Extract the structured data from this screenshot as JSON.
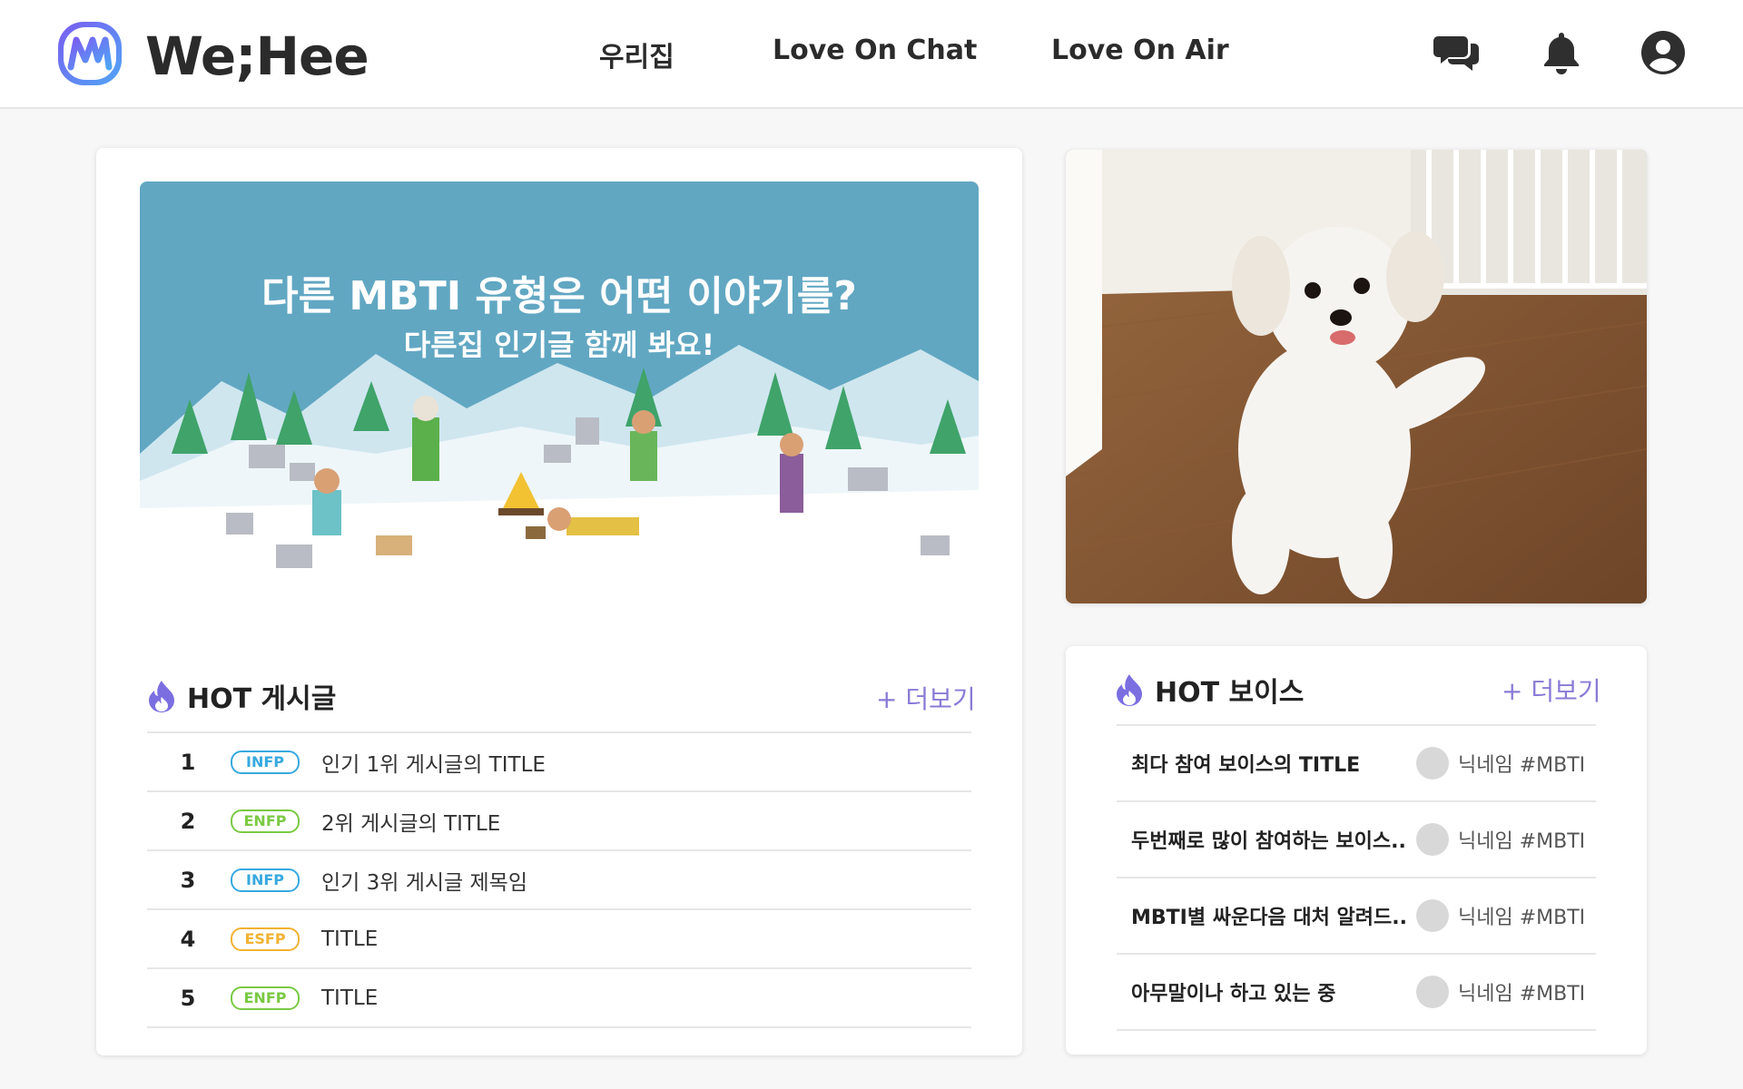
{
  "app": {
    "name": "We;Hee",
    "accent": "#8a7ad6",
    "logo_color": "#6a6cf0"
  },
  "nav": {
    "items": [
      {
        "label": "우리집"
      },
      {
        "label": "Love On Chat"
      },
      {
        "label": "Love On Air"
      }
    ],
    "icons": [
      "chat-bubbles-icon",
      "bell-icon",
      "user-account-icon"
    ]
  },
  "banner": {
    "title": "다른 MBTI 유형은 어떤 이야기를?",
    "subtitle": "다른집 인기글 함께 봐요!"
  },
  "hot_posts": {
    "title": "HOT 게시글",
    "more_label": "+ 더보기",
    "items": [
      {
        "rank": "1",
        "mbti": "INFP",
        "mbti_color": "#37a9e0",
        "title": "인기 1위 게시글의 TITLE"
      },
      {
        "rank": "2",
        "mbti": "ENFP",
        "mbti_color": "#7ac943",
        "title": "2위 게시글의 TITLE"
      },
      {
        "rank": "3",
        "mbti": "INFP",
        "mbti_color": "#37a9e0",
        "title": "인기 3위 게시글 제목임"
      },
      {
        "rank": "4",
        "mbti": "ESFP",
        "mbti_color": "#f2b233",
        "title": "TITLE"
      },
      {
        "rank": "5",
        "mbti": "ENFP",
        "mbti_color": "#7ac943",
        "title": "TITLE"
      }
    ]
  },
  "hot_voices": {
    "title": "HOT 보이스",
    "more_label": "+ 더보기",
    "items": [
      {
        "title": "최다 참여 보이스의 TITLE",
        "nickname": "닉네임 #MBTI"
      },
      {
        "title": "두번째로 많이 참여하는 보이스..",
        "nickname": "닉네임 #MBTI"
      },
      {
        "title": "MBTI별 싸운다음 대처 알려드..",
        "nickname": "닉네임 #MBTI"
      },
      {
        "title": "아무말이나 하고 있는 중",
        "nickname": "닉네임 #MBTI"
      }
    ]
  }
}
